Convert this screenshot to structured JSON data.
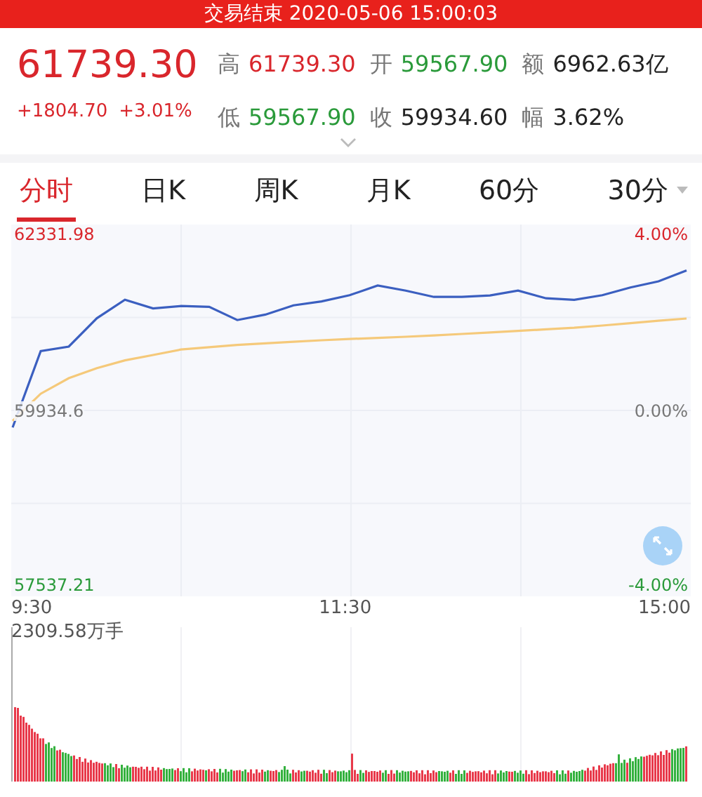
{
  "banner": {
    "text": "交易结束 2020-05-06 15:00:03"
  },
  "quote": {
    "price": "61739.30",
    "change": "+1804.70",
    "change_percent": "+3.01%",
    "color": "#d9262c",
    "stats": [
      {
        "label": "高",
        "value": "61739.30",
        "color": "#d9262c"
      },
      {
        "label": "开",
        "value": "59567.90",
        "color": "#2a9a3a"
      },
      {
        "label": "额",
        "value": "6962.63亿",
        "color": "#222222"
      },
      {
        "label": "低",
        "value": "59567.90",
        "color": "#2a9a3a"
      },
      {
        "label": "收",
        "value": "59934.60",
        "color": "#222222"
      },
      {
        "label": "幅",
        "value": "3.62%",
        "color": "#222222"
      }
    ]
  },
  "tabs": [
    {
      "label": "分时",
      "selected": true,
      "has_menu": false
    },
    {
      "label": "日K",
      "selected": false,
      "has_menu": false
    },
    {
      "label": "周K",
      "selected": false,
      "has_menu": false
    },
    {
      "label": "月K",
      "selected": false,
      "has_menu": false
    },
    {
      "label": "60分",
      "selected": false,
      "has_menu": false
    },
    {
      "label": "30分",
      "selected": false,
      "has_menu": true
    }
  ],
  "price_chart": {
    "percent_labels": [
      {
        "text": "4.00%",
        "color": "#d9262c"
      },
      {
        "text": "0.00%",
        "color": "#777777"
      },
      {
        "text": "-4.00%",
        "color": "#2a9a3a"
      }
    ],
    "price_labels": [
      {
        "text": "62331.98",
        "color": "#d9262c"
      },
      {
        "text": "59934.6",
        "color": "#777777"
      },
      {
        "text": "57537.21",
        "color": "#2a9a3a"
      }
    ],
    "time_labels": [
      "9:30",
      "11:30",
      "15:00"
    ]
  },
  "volume_chart": {
    "max_label": "2309.58万手"
  }
}
